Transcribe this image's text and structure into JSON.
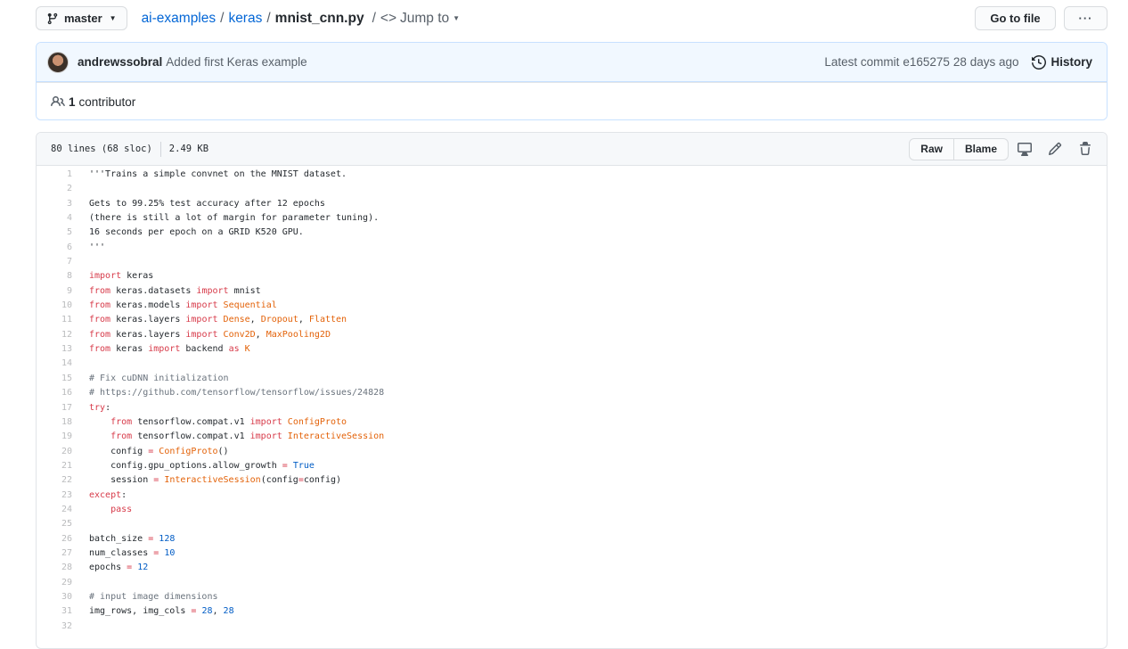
{
  "top_bar": {
    "branch": "master",
    "breadcrumb": {
      "repo": "ai-examples",
      "folder": "keras",
      "file": "mnist_cnn.py",
      "jump_to": "Jump to"
    },
    "go_to_file": "Go to file",
    "more": "···"
  },
  "commit": {
    "author": "andrewssobral",
    "message": "Added first Keras example",
    "latest_label": "Latest commit",
    "sha": "e165275",
    "age": "28 days ago",
    "history": "History"
  },
  "contributors": {
    "count": "1",
    "label": "contributor"
  },
  "file": {
    "lines_info": "80 lines (68 sloc)",
    "size": "2.49 KB",
    "raw": "Raw",
    "blame": "Blame"
  },
  "code_lines": [
    {
      "n": "1",
      "tokens": [
        [
          "",
          "'''Trains a simple convnet on the MNIST dataset."
        ]
      ]
    },
    {
      "n": "2",
      "tokens": []
    },
    {
      "n": "3",
      "tokens": [
        [
          "",
          "Gets to 99.25% test accuracy after 12 epochs"
        ]
      ]
    },
    {
      "n": "4",
      "tokens": [
        [
          "",
          "(there is still a lot of margin for parameter tuning)."
        ]
      ]
    },
    {
      "n": "5",
      "tokens": [
        [
          "",
          "16 seconds per epoch on a GRID K520 GPU."
        ]
      ]
    },
    {
      "n": "6",
      "tokens": [
        [
          "",
          "'''"
        ]
      ]
    },
    {
      "n": "7",
      "tokens": []
    },
    {
      "n": "8",
      "tokens": [
        [
          "k",
          "import"
        ],
        [
          "",
          " keras"
        ]
      ]
    },
    {
      "n": "9",
      "tokens": [
        [
          "k",
          "from"
        ],
        [
          "",
          " keras.datasets "
        ],
        [
          "k",
          "import"
        ],
        [
          "",
          " mnist"
        ]
      ]
    },
    {
      "n": "10",
      "tokens": [
        [
          "k",
          "from"
        ],
        [
          "",
          " keras.models "
        ],
        [
          "k",
          "import"
        ],
        [
          "",
          " "
        ],
        [
          "en",
          "Sequential"
        ]
      ]
    },
    {
      "n": "11",
      "tokens": [
        [
          "k",
          "from"
        ],
        [
          "",
          " keras.layers "
        ],
        [
          "k",
          "import"
        ],
        [
          "",
          " "
        ],
        [
          "en",
          "Dense"
        ],
        [
          "",
          ", "
        ],
        [
          "en",
          "Dropout"
        ],
        [
          "",
          ", "
        ],
        [
          "en",
          "Flatten"
        ]
      ]
    },
    {
      "n": "12",
      "tokens": [
        [
          "k",
          "from"
        ],
        [
          "",
          " keras.layers "
        ],
        [
          "k",
          "import"
        ],
        [
          "",
          " "
        ],
        [
          "en",
          "Conv2D"
        ],
        [
          "",
          ", "
        ],
        [
          "en",
          "MaxPooling2D"
        ]
      ]
    },
    {
      "n": "13",
      "tokens": [
        [
          "k",
          "from"
        ],
        [
          "",
          " keras "
        ],
        [
          "k",
          "import"
        ],
        [
          "",
          " backend "
        ],
        [
          "k",
          "as"
        ],
        [
          "",
          " "
        ],
        [
          "en",
          "K"
        ]
      ]
    },
    {
      "n": "14",
      "tokens": []
    },
    {
      "n": "15",
      "tokens": [
        [
          "c",
          "# Fix cuDNN initialization"
        ]
      ]
    },
    {
      "n": "16",
      "tokens": [
        [
          "c",
          "# https://github.com/tensorflow/tensorflow/issues/24828"
        ]
      ]
    },
    {
      "n": "17",
      "tokens": [
        [
          "k",
          "try"
        ],
        [
          "",
          ":"
        ]
      ]
    },
    {
      "n": "18",
      "tokens": [
        [
          "",
          "    "
        ],
        [
          "k",
          "from"
        ],
        [
          "",
          " tensorflow.compat.v1 "
        ],
        [
          "k",
          "import"
        ],
        [
          "",
          " "
        ],
        [
          "en",
          "ConfigProto"
        ]
      ]
    },
    {
      "n": "19",
      "tokens": [
        [
          "",
          "    "
        ],
        [
          "k",
          "from"
        ],
        [
          "",
          " tensorflow.compat.v1 "
        ],
        [
          "k",
          "import"
        ],
        [
          "",
          " "
        ],
        [
          "en",
          "InteractiveSession"
        ]
      ]
    },
    {
      "n": "20",
      "tokens": [
        [
          "",
          "    config "
        ],
        [
          "o",
          "="
        ],
        [
          "",
          " "
        ],
        [
          "en",
          "ConfigProto"
        ],
        [
          "",
          "()"
        ]
      ]
    },
    {
      "n": "21",
      "tokens": [
        [
          "",
          "    config.gpu_options.allow_growth "
        ],
        [
          "o",
          "="
        ],
        [
          "",
          " "
        ],
        [
          "n",
          "True"
        ]
      ]
    },
    {
      "n": "22",
      "tokens": [
        [
          "",
          "    session "
        ],
        [
          "o",
          "="
        ],
        [
          "",
          " "
        ],
        [
          "en",
          "InteractiveSession"
        ],
        [
          "",
          "(config"
        ],
        [
          "o",
          "="
        ],
        [
          "",
          "config)"
        ]
      ]
    },
    {
      "n": "23",
      "tokens": [
        [
          "k",
          "except"
        ],
        [
          "",
          ":"
        ]
      ]
    },
    {
      "n": "24",
      "tokens": [
        [
          "",
          "    "
        ],
        [
          "k",
          "pass"
        ]
      ]
    },
    {
      "n": "25",
      "tokens": []
    },
    {
      "n": "26",
      "tokens": [
        [
          "",
          "batch_size "
        ],
        [
          "o",
          "="
        ],
        [
          "",
          " "
        ],
        [
          "n",
          "128"
        ]
      ]
    },
    {
      "n": "27",
      "tokens": [
        [
          "",
          "num_classes "
        ],
        [
          "o",
          "="
        ],
        [
          "",
          " "
        ],
        [
          "n",
          "10"
        ]
      ]
    },
    {
      "n": "28",
      "tokens": [
        [
          "",
          "epochs "
        ],
        [
          "o",
          "="
        ],
        [
          "",
          " "
        ],
        [
          "n",
          "12"
        ]
      ]
    },
    {
      "n": "29",
      "tokens": []
    },
    {
      "n": "30",
      "tokens": [
        [
          "c",
          "# input image dimensions"
        ]
      ]
    },
    {
      "n": "31",
      "tokens": [
        [
          "",
          "img_rows, img_cols "
        ],
        [
          "o",
          "="
        ],
        [
          "",
          " "
        ],
        [
          "n",
          "28"
        ],
        [
          "",
          ", "
        ],
        [
          "n",
          "28"
        ]
      ]
    },
    {
      "n": "32",
      "tokens": []
    }
  ]
}
